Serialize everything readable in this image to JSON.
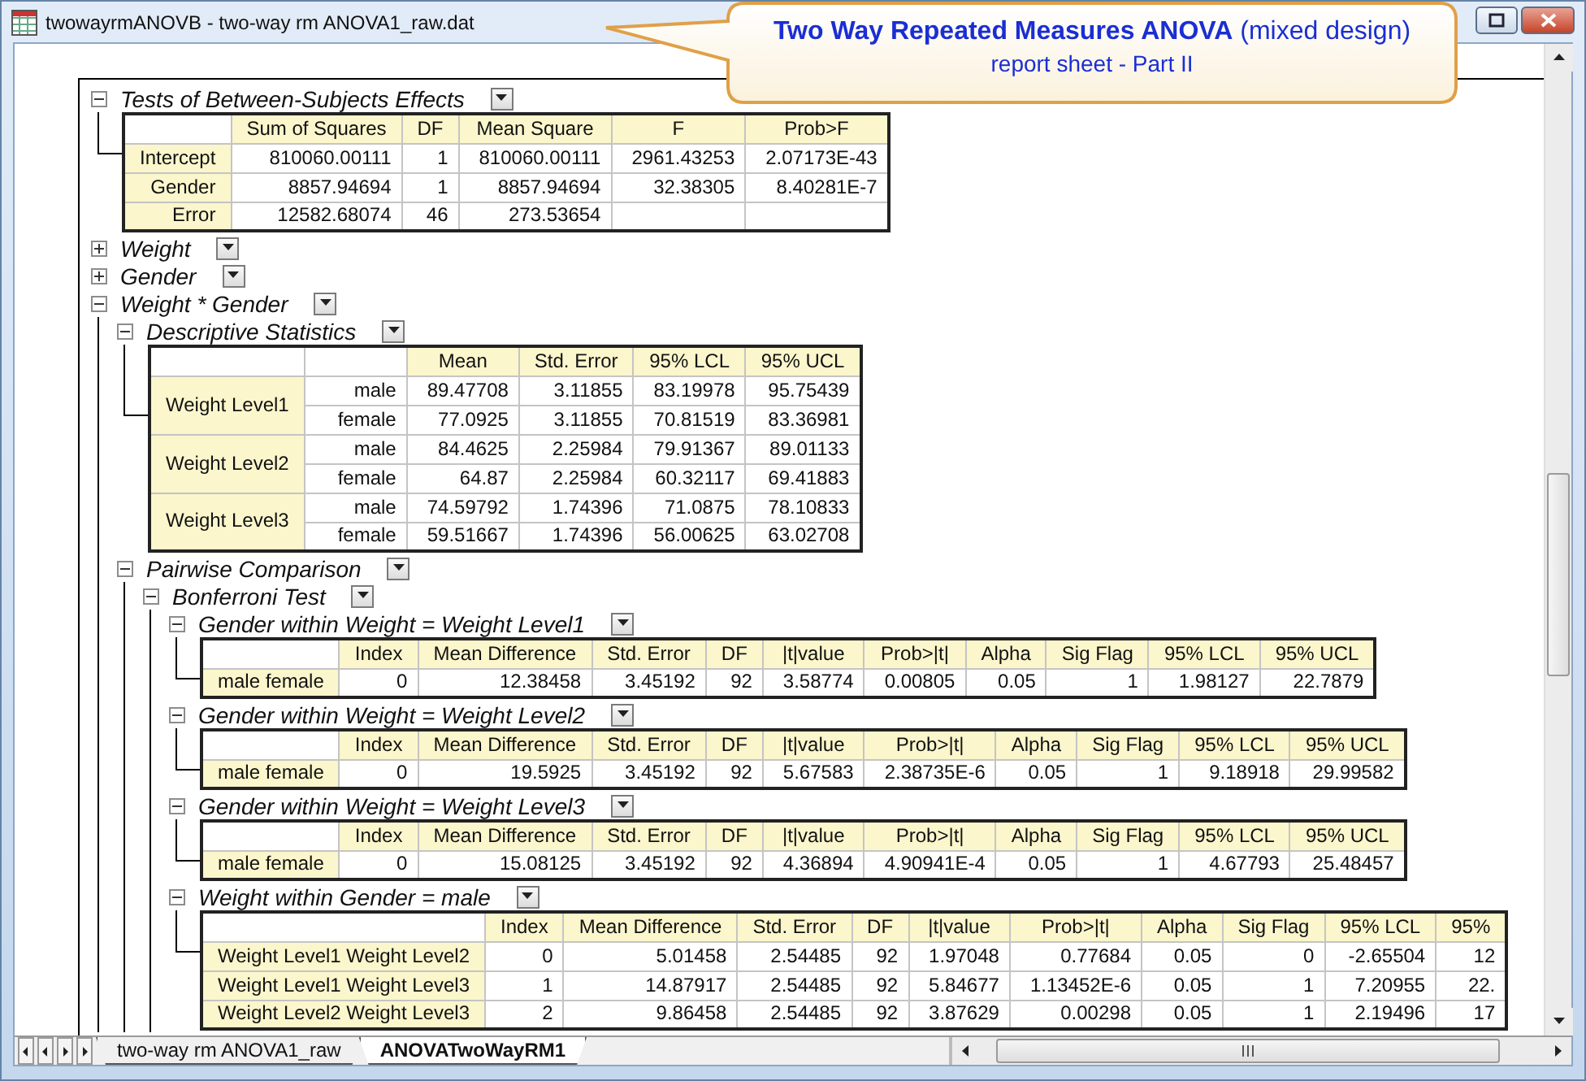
{
  "window": {
    "title": "twowayrmANOVB - two-way rm ANOVA1_raw.dat"
  },
  "callout": {
    "heading": "**Two Way Repeated Measures ANOVA** (mixed design)",
    "subheading": "report sheet - Part II"
  },
  "report": [
    {
      "title": "Tests of Between-Subjects Effects",
      "expanded": true,
      "kind": "table",
      "table": {
        "columns": [
          "Sum of Squares",
          "DF",
          "Mean Square",
          "F",
          "Prob>F"
        ],
        "rows": [
          {
            "label": "Intercept",
            "cells": [
              "810060.00111",
              "1",
              "810060.00111",
              "2961.43253",
              "2.07173E-43"
            ]
          },
          {
            "label": "Gender",
            "cells": [
              "8857.94694",
              "1",
              "8857.94694",
              "32.38305",
              "8.40281E-7"
            ]
          },
          {
            "label": "Error",
            "cells": [
              "12582.68074",
              "46",
              "273.53654"
            ]
          }
        ]
      }
    },
    {
      "title": "Weight",
      "expanded": false
    },
    {
      "title": "Gender",
      "expanded": false
    },
    {
      "title": "Weight * Gender",
      "expanded": true,
      "kind": "group",
      "children": [
        {
          "title": "Descriptive Statistics",
          "expanded": true,
          "kind": "grouped",
          "table": {
            "columns": [
              "Mean",
              "Std. Error",
              "95% LCL",
              "95% UCL"
            ],
            "groups": [
              {
                "label": "Weight Level1",
                "rows": [
                  {
                    "label": "male",
                    "cells": [
                      "89.47708",
                      "3.11855",
                      "83.19978",
                      "95.75439"
                    ]
                  },
                  {
                    "label": "female",
                    "cells": [
                      "77.0925",
                      "3.11855",
                      "70.81519",
                      "83.36981"
                    ]
                  }
                ]
              },
              {
                "label": "Weight Level2",
                "rows": [
                  {
                    "label": "male",
                    "cells": [
                      "84.4625",
                      "2.25984",
                      "79.91367",
                      "89.01133"
                    ]
                  },
                  {
                    "label": "female",
                    "cells": [
                      "64.87",
                      "2.25984",
                      "60.32117",
                      "69.41883"
                    ]
                  }
                ]
              },
              {
                "label": "Weight Level3",
                "rows": [
                  {
                    "label": "male",
                    "cells": [
                      "74.59792",
                      "1.74396",
                      "71.0875",
                      "78.10833"
                    ]
                  },
                  {
                    "label": "female",
                    "cells": [
                      "59.51667",
                      "1.74396",
                      "56.00625",
                      "63.02708"
                    ]
                  }
                ]
              }
            ]
          }
        },
        {
          "title": "Pairwise Comparison",
          "expanded": true,
          "kind": "group",
          "children": [
            {
              "title": "Bonferroni Test",
              "expanded": true,
              "kind": "group",
              "children": [
                {
                  "title": "Gender within Weight = Weight Level1",
                  "expanded": true,
                  "kind": "table",
                  "table": {
                    "columns": [
                      "Index",
                      "Mean Difference",
                      "Std. Error",
                      "DF",
                      "|t|value",
                      "Prob>|t|",
                      "Alpha",
                      "Sig Flag",
                      "95% LCL",
                      "95% UCL"
                    ],
                    "rows": [
                      {
                        "label": "male female",
                        "cells": [
                          "0",
                          "12.38458",
                          "3.45192",
                          "92",
                          "3.58774",
                          "0.00805",
                          "0.05",
                          "1",
                          "1.98127",
                          "22.7879"
                        ]
                      }
                    ]
                  }
                },
                {
                  "title": "Gender within Weight = Weight Level2",
                  "expanded": true,
                  "kind": "table",
                  "table": {
                    "columns": [
                      "Index",
                      "Mean Difference",
                      "Std. Error",
                      "DF",
                      "|t|value",
                      "Prob>|t|",
                      "Alpha",
                      "Sig Flag",
                      "95% LCL",
                      "95% UCL"
                    ],
                    "rows": [
                      {
                        "label": "male female",
                        "cells": [
                          "0",
                          "19.5925",
                          "3.45192",
                          "92",
                          "5.67583",
                          "2.38735E-6",
                          "0.05",
                          "1",
                          "9.18918",
                          "29.99582"
                        ]
                      }
                    ]
                  }
                },
                {
                  "title": "Gender within Weight = Weight Level3",
                  "expanded": true,
                  "kind": "table",
                  "table": {
                    "columns": [
                      "Index",
                      "Mean Difference",
                      "Std. Error",
                      "DF",
                      "|t|value",
                      "Prob>|t|",
                      "Alpha",
                      "Sig Flag",
                      "95% LCL",
                      "95% UCL"
                    ],
                    "rows": [
                      {
                        "label": "male female",
                        "cells": [
                          "0",
                          "15.08125",
                          "3.45192",
                          "92",
                          "4.36894",
                          "4.90941E-4",
                          "0.05",
                          "1",
                          "4.67793",
                          "25.48457"
                        ]
                      }
                    ]
                  }
                },
                {
                  "title": "Weight within Gender = male",
                  "expanded": true,
                  "kind": "table",
                  "table": {
                    "columns": [
                      "Index",
                      "Mean Difference",
                      "Std. Error",
                      "DF",
                      "|t|value",
                      "Prob>|t|",
                      "Alpha",
                      "Sig Flag",
                      "95% LCL",
                      "95%"
                    ],
                    "rows": [
                      {
                        "label": "Weight Level1 Weight Level2",
                        "cells": [
                          "0",
                          "5.01458",
                          "2.54485",
                          "92",
                          "1.97048",
                          "0.77684",
                          "0.05",
                          "0",
                          "-2.65504",
                          "12"
                        ]
                      },
                      {
                        "label": "Weight Level1 Weight Level3",
                        "cells": [
                          "1",
                          "14.87917",
                          "2.54485",
                          "92",
                          "5.84677",
                          "1.13452E-6",
                          "0.05",
                          "1",
                          "7.20955",
                          "22."
                        ]
                      },
                      {
                        "label": "Weight Level2 Weight Level3",
                        "cells": [
                          "2",
                          "9.86458",
                          "2.54485",
                          "92",
                          "3.87629",
                          "0.00298",
                          "0.05",
                          "1",
                          "2.19496",
                          "17"
                        ]
                      }
                    ]
                  }
                }
              ]
            }
          ]
        }
      ]
    }
  ],
  "sheet_tabs": [
    {
      "label": "two-way rm ANOVA1_raw",
      "selected": false
    },
    {
      "label": "ANOVATwoWayRM1",
      "selected": true
    }
  ]
}
